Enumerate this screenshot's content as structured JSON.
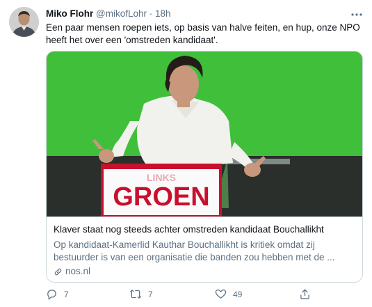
{
  "tweet": {
    "author_name": "Miko Flohr",
    "handle": "@mikofLohr",
    "separator": "·",
    "time": "18h",
    "text": "Een paar mensen roepen iets, op basis van halve feiten, en hup, onze NPO heeft het over een 'omstreden kandidaat'.",
    "more_icon": "more-horizontal-icon"
  },
  "card": {
    "image_sign_text": "GROEN",
    "image_sign_subtext": "LINKS",
    "title": "Klaver staat nog steeds achter omstreden kandidaat Bouchallikht",
    "description": "Op kandidaat-Kamerlid Kauthar Bouchallikht is kritiek omdat zij bestuurder is van een organisatie die banden zou hebben met de ...",
    "domain": "nos.nl",
    "domain_icon": "link-icon"
  },
  "actions": {
    "reply_count": "7",
    "retweet_count": "7",
    "like_count": "49",
    "reply_icon": "reply-icon",
    "retweet_icon": "retweet-icon",
    "like_icon": "heart-icon",
    "share_icon": "share-icon"
  },
  "colors": {
    "text_primary": "#0f1419",
    "text_secondary": "#5b7083",
    "border": "#cfd9de",
    "image_background": "#3fbf3a",
    "sign_red": "#c8102e"
  }
}
